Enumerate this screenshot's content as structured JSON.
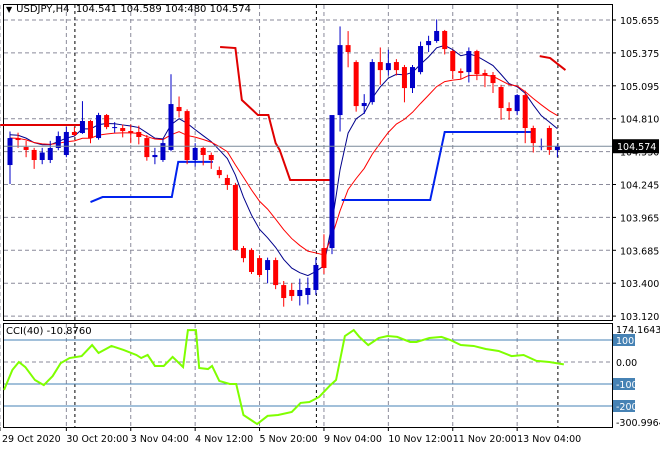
{
  "header": {
    "symbol": "USDJPY,H4",
    "ohlc": "104.541 104.589 104:480 104.574"
  },
  "price_axis": {
    "labels": [
      "105.655",
      "105.375",
      "105.095",
      "104.810",
      "104.530",
      "104.245",
      "103.965",
      "103.685",
      "103.400",
      "103.120"
    ],
    "current": "104.574",
    "current_value": 104.574
  },
  "cci": {
    "title": "CCI(40) -10.8760",
    "max_label": "174.1643",
    "min_label": "-300.9964",
    "levels": [
      "100",
      "0.00",
      "-100",
      "-200"
    ],
    "points": [
      [
        -0.8,
        -127
      ],
      [
        0.3,
        -36
      ],
      [
        1.1,
        0
      ],
      [
        1.9,
        -23
      ],
      [
        3.1,
        -82
      ],
      [
        4.2,
        -105
      ],
      [
        5.3,
        -64
      ],
      [
        6.3,
        -5
      ],
      [
        7.4,
        18
      ],
      [
        8.9,
        27
      ],
      [
        10.2,
        77
      ],
      [
        11,
        41
      ],
      [
        12.6,
        73
      ],
      [
        14.1,
        55
      ],
      [
        15.7,
        32
      ],
      [
        16.3,
        18
      ],
      [
        17.1,
        32
      ],
      [
        18,
        -18
      ],
      [
        19.1,
        -18
      ],
      [
        20.2,
        23
      ],
      [
        21,
        -5
      ],
      [
        21.5,
        -23
      ],
      [
        22.1,
        145
      ],
      [
        23.1,
        145
      ],
      [
        23.5,
        -27
      ],
      [
        24.6,
        -32
      ],
      [
        25.1,
        -18
      ],
      [
        26,
        -86
      ],
      [
        27.3,
        -100
      ],
      [
        28.1,
        -100
      ],
      [
        29,
        -241
      ],
      [
        30.7,
        -282
      ],
      [
        32,
        -245
      ],
      [
        33.3,
        -241
      ],
      [
        35,
        -227
      ],
      [
        36.1,
        -186
      ],
      [
        37.2,
        -182
      ],
      [
        38.4,
        -159
      ],
      [
        39.8,
        -105
      ],
      [
        40.5,
        -82
      ],
      [
        41.6,
        118
      ],
      [
        42.7,
        145
      ],
      [
        43.4,
        114
      ],
      [
        44.5,
        77
      ],
      [
        45.8,
        109
      ],
      [
        46.9,
        118
      ],
      [
        48.1,
        114
      ],
      [
        49.7,
        91
      ],
      [
        50.5,
        91
      ],
      [
        52.1,
        109
      ],
      [
        53.6,
        114
      ],
      [
        54.7,
        100
      ],
      [
        56,
        77
      ],
      [
        57.6,
        73
      ],
      [
        59.1,
        59
      ],
      [
        60.7,
        50
      ],
      [
        62.3,
        27
      ],
      [
        63.8,
        32
      ],
      [
        65.4,
        5
      ],
      [
        67,
        0
      ],
      [
        68.8,
        -11
      ]
    ]
  },
  "time_axis": [
    {
      "label": "29 Oct 2020",
      "i": -1
    },
    {
      "label": "30 Oct 20:00",
      "i": 7
    },
    {
      "label": "3 Nov 04:00",
      "i": 15
    },
    {
      "label": "4 Nov 12:00",
      "i": 23
    },
    {
      "label": "5 Nov 20:00",
      "i": 31
    },
    {
      "label": "9 Nov 04:00",
      "i": 39
    },
    {
      "label": "10 Nov 12:00",
      "i": 47
    },
    {
      "label": "11 Nov 20:00",
      "i": 55
    },
    {
      "label": "13 Nov 04:00",
      "i": 63
    }
  ],
  "separators": [
    8,
    38,
    68
  ],
  "colors": {
    "bull": "#0000c8",
    "bear": "#ff0000",
    "cci": "#7fff00",
    "level": "#4682b4"
  },
  "candles": [
    [
      104.413,
      104.7,
      104.25,
      104.644
    ],
    [
      104.644,
      104.69,
      104.56,
      104.627
    ],
    [
      104.567,
      104.62,
      104.48,
      104.542
    ],
    [
      104.542,
      104.56,
      104.38,
      104.456
    ],
    [
      104.456,
      104.56,
      104.42,
      104.52
    ],
    [
      104.456,
      104.62,
      104.43,
      104.559
    ],
    [
      104.559,
      104.7,
      104.54,
      104.661
    ],
    [
      104.499,
      104.74,
      104.48,
      104.696
    ],
    [
      104.696,
      104.74,
      104.66,
      104.67
    ],
    [
      104.687,
      104.96,
      104.68,
      104.79
    ],
    [
      104.79,
      104.8,
      104.6,
      104.644
    ],
    [
      104.644,
      104.86,
      104.63,
      104.841
    ],
    [
      104.841,
      104.85,
      104.72,
      104.738
    ],
    [
      104.73,
      104.78,
      104.69,
      104.738
    ],
    [
      104.73,
      104.76,
      104.65,
      104.704
    ],
    [
      104.704,
      104.76,
      104.6,
      104.687
    ],
    [
      104.696,
      104.75,
      104.59,
      104.653
    ],
    [
      104.644,
      104.67,
      104.45,
      104.481
    ],
    [
      104.481,
      104.56,
      104.42,
      104.499
    ],
    [
      104.456,
      104.64,
      104.44,
      104.601
    ],
    [
      104.542,
      105.19,
      104.53,
      104.935
    ],
    [
      104.91,
      105.0,
      104.82,
      104.875
    ],
    [
      104.875,
      104.89,
      104.42,
      104.456
    ],
    [
      104.456,
      104.6,
      104.4,
      104.559
    ],
    [
      104.559,
      104.57,
      104.41,
      104.499
    ],
    [
      104.499,
      104.52,
      104.38,
      104.456
    ],
    [
      104.37,
      104.4,
      104.3,
      104.327
    ],
    [
      104.302,
      104.33,
      104.2,
      104.242
    ],
    [
      104.242,
      104.26,
      103.68,
      103.685
    ],
    [
      103.702,
      103.72,
      103.58,
      103.616
    ],
    [
      103.685,
      103.7,
      103.48,
      103.497
    ],
    [
      103.616,
      103.64,
      103.45,
      103.471
    ],
    [
      103.514,
      103.62,
      103.4,
      103.599
    ],
    [
      103.599,
      103.62,
      103.35,
      103.385
    ],
    [
      103.385,
      103.42,
      103.2,
      103.274
    ],
    [
      103.343,
      103.4,
      103.25,
      103.291
    ],
    [
      103.291,
      103.44,
      103.21,
      103.343
    ],
    [
      103.3,
      103.45,
      103.22,
      103.36
    ],
    [
      103.343,
      103.62,
      103.3,
      103.557
    ],
    [
      103.702,
      103.82,
      103.48,
      103.531
    ],
    [
      103.702,
      104.8,
      103.65,
      104.841
    ],
    [
      104.841,
      105.6,
      104.7,
      105.44
    ],
    [
      105.44,
      105.56,
      105.25,
      105.381
    ],
    [
      105.295,
      105.31,
      104.87,
      104.918
    ],
    [
      104.918,
      105.02,
      104.85,
      104.944
    ],
    [
      104.952,
      105.32,
      104.93,
      105.295
    ],
    [
      105.295,
      105.42,
      105.1,
      105.226
    ],
    [
      105.226,
      105.4,
      105.18,
      105.286
    ],
    [
      105.295,
      105.32,
      105.18,
      105.226
    ],
    [
      105.252,
      105.27,
      104.95,
      105.072
    ],
    [
      105.072,
      105.27,
      105.03,
      105.252
    ],
    [
      105.209,
      105.47,
      105.19,
      105.432
    ],
    [
      105.44,
      105.52,
      105.38,
      105.475
    ],
    [
      105.475,
      105.66,
      105.46,
      105.561
    ],
    [
      105.561,
      105.57,
      105.36,
      105.406
    ],
    [
      105.389,
      105.4,
      105.15,
      105.218
    ],
    [
      105.218,
      105.24,
      105.15,
      105.201
    ],
    [
      105.209,
      105.42,
      105.12,
      105.389
    ],
    [
      105.389,
      105.4,
      105.14,
      105.192
    ],
    [
      105.201,
      105.23,
      105.08,
      105.184
    ],
    [
      105.184,
      105.21,
      105.03,
      105.115
    ],
    [
      105.081,
      105.1,
      104.8,
      104.901
    ],
    [
      104.901,
      104.95,
      104.8,
      104.875
    ],
    [
      104.875,
      105.02,
      104.84,
      105.012
    ],
    [
      105.012,
      105.05,
      104.6,
      104.73
    ],
    [
      104.73,
      104.75,
      104.52,
      104.601
    ],
    [
      104.567,
      104.64,
      104.54,
      104.575
    ],
    [
      104.73,
      104.75,
      104.5,
      104.542
    ],
    [
      104.541,
      104.589,
      104.48,
      104.574
    ]
  ],
  "step_lines": {
    "red": [
      [
        [
          -1.2,
          104.756
        ],
        [
          9.1,
          104.756
        ],
        [
          9.1,
          104.72
        ]
      ],
      [
        [
          26.1,
          105.424
        ],
        [
          28,
          105.415
        ],
        [
          28.8,
          104.97
        ],
        [
          30.8,
          104.841
        ],
        [
          32.1,
          104.841
        ],
        [
          33,
          104.601
        ],
        [
          33.5,
          104.542
        ],
        [
          34.8,
          104.285
        ],
        [
          39.8,
          104.285
        ]
      ],
      [
        [
          65.8,
          105.346
        ],
        [
          67.1,
          105.329
        ],
        [
          69,
          105.226
        ]
      ]
    ],
    "blue": [
      [
        [
          10,
          104.096
        ],
        [
          11.5,
          104.139
        ],
        [
          20.1,
          104.139
        ],
        [
          20.9,
          104.44
        ],
        [
          25.2,
          104.44
        ]
      ],
      [
        [
          41.2,
          104.113
        ],
        [
          52.2,
          104.113
        ],
        [
          54.0,
          104.696
        ],
        [
          64.8,
          104.696
        ],
        [
          64.8,
          104.64
        ]
      ]
    ]
  }
}
